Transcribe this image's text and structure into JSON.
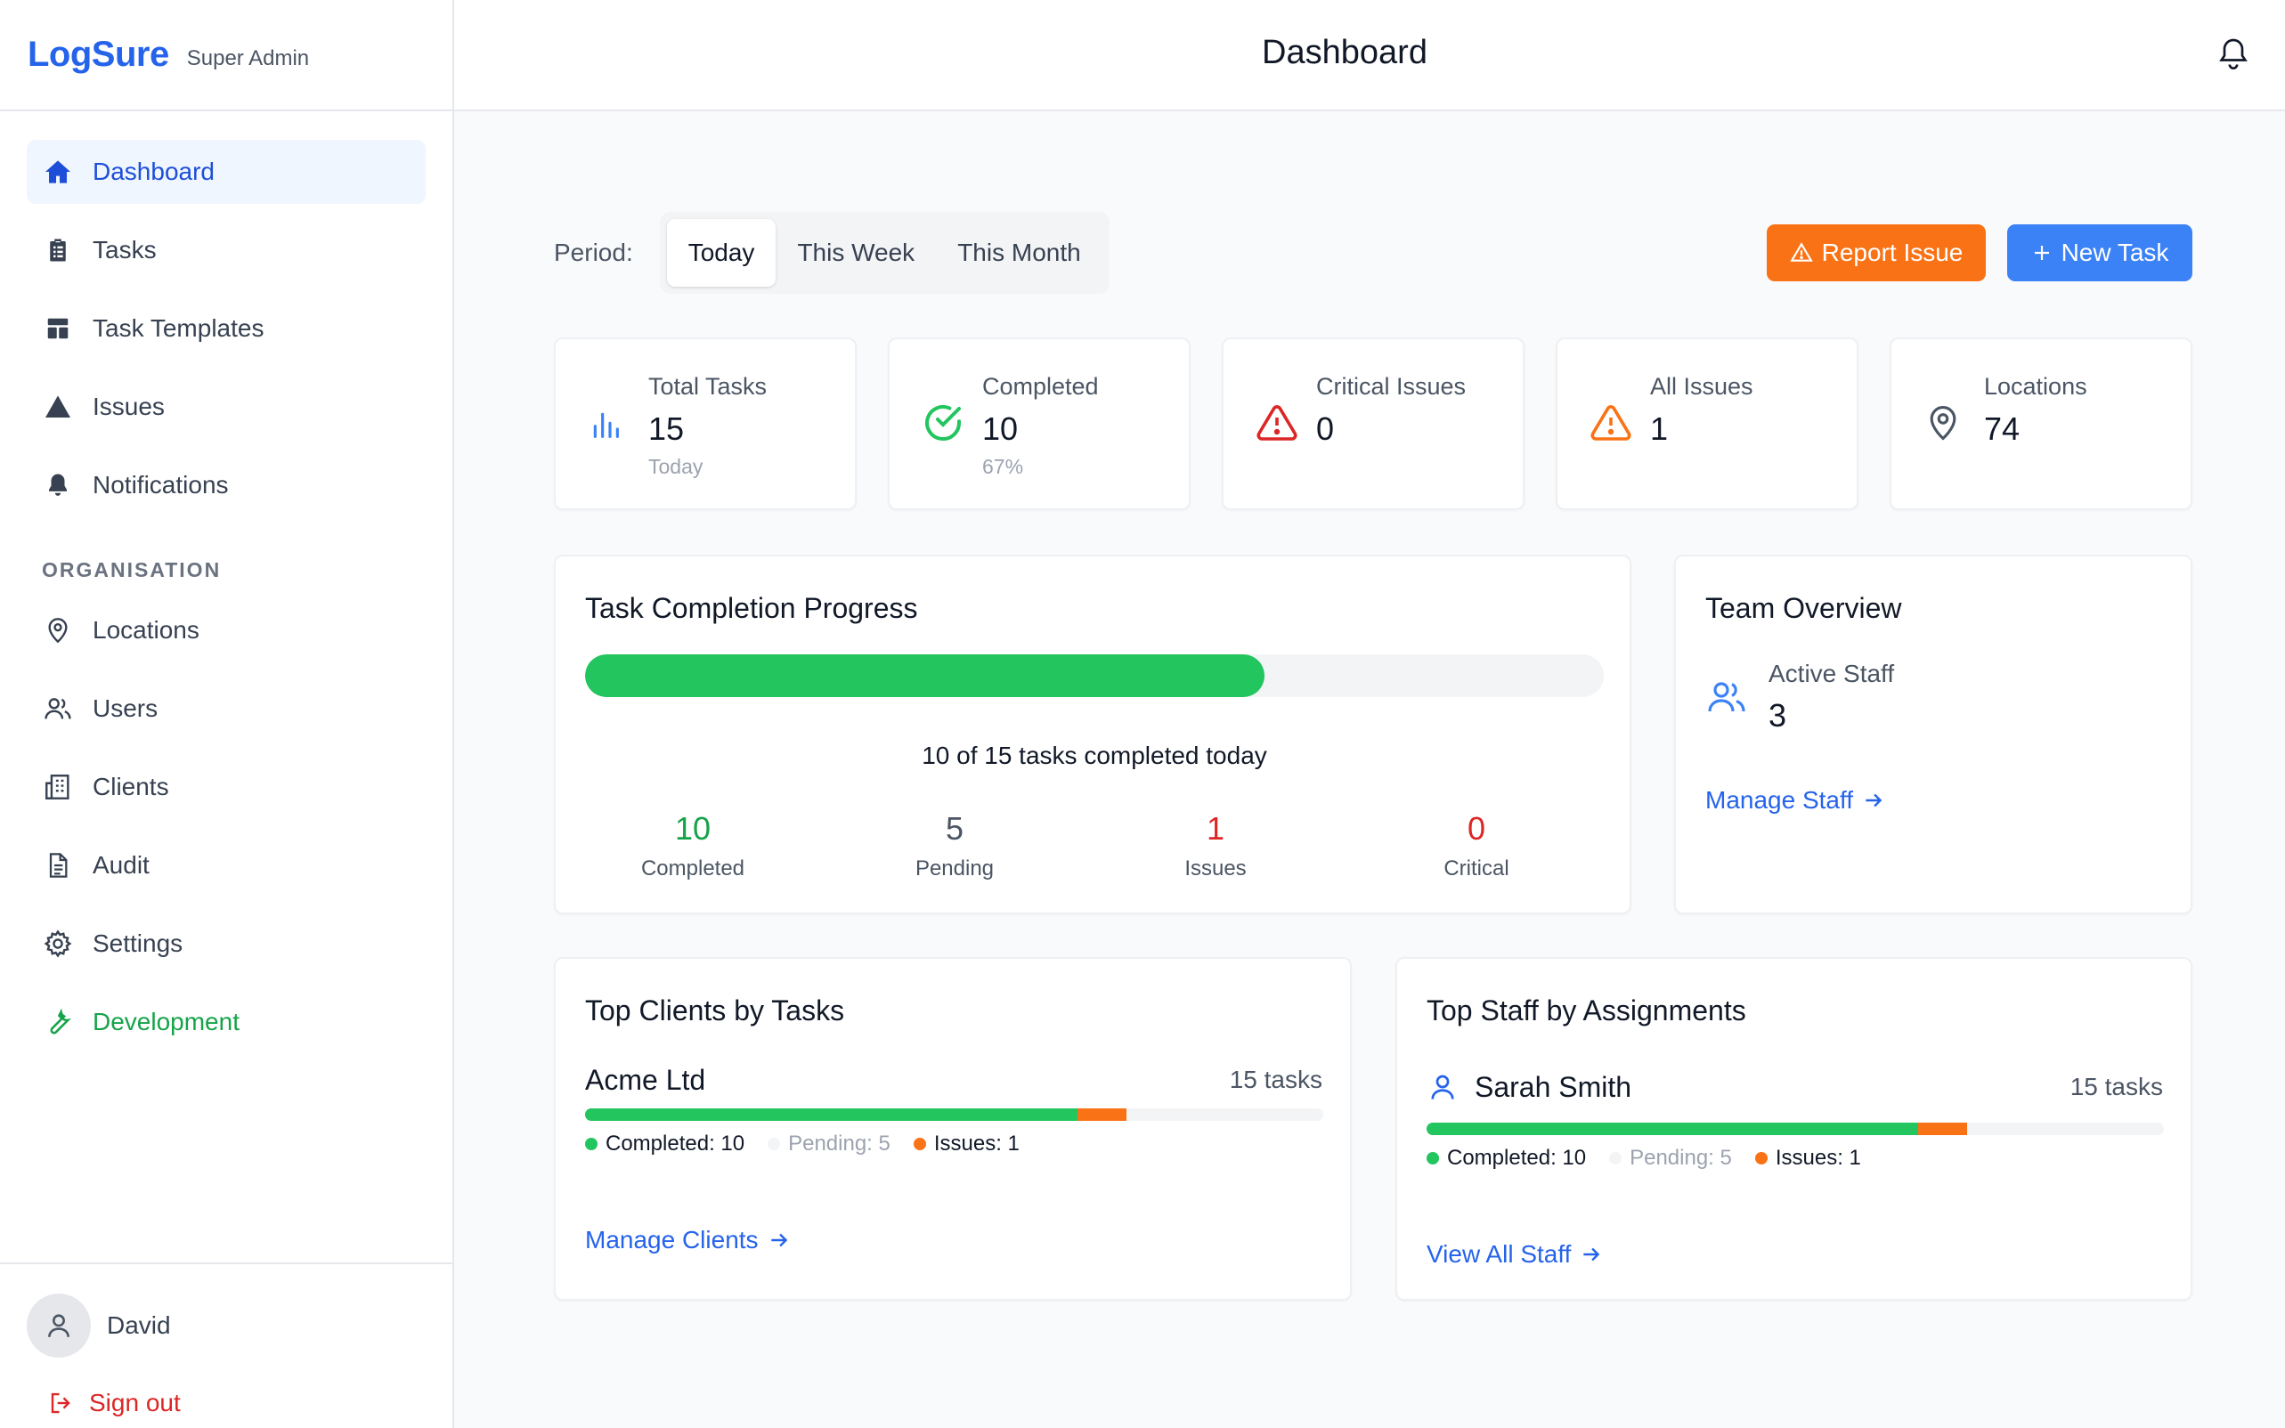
{
  "app": {
    "name": "LogSure",
    "role": "Super Admin"
  },
  "header": {
    "title": "Dashboard"
  },
  "sidebar": {
    "items": [
      {
        "label": "Dashboard",
        "icon": "home-icon"
      },
      {
        "label": "Tasks",
        "icon": "clipboard-icon"
      },
      {
        "label": "Task Templates",
        "icon": "template-icon"
      },
      {
        "label": "Issues",
        "icon": "triangle-icon"
      },
      {
        "label": "Notifications",
        "icon": "bell-icon"
      }
    ],
    "section_label": "ORGANISATION",
    "org_items": [
      {
        "label": "Locations",
        "icon": "map-pin-icon"
      },
      {
        "label": "Users",
        "icon": "users-icon"
      },
      {
        "label": "Clients",
        "icon": "building-icon"
      },
      {
        "label": "Audit",
        "icon": "document-icon"
      },
      {
        "label": "Settings",
        "icon": "gear-icon"
      },
      {
        "label": "Development",
        "icon": "wrench-icon"
      }
    ],
    "user_name": "David",
    "signout_label": "Sign out"
  },
  "period": {
    "label": "Period:",
    "options": [
      "Today",
      "This Week",
      "This Month"
    ],
    "selected": "Today"
  },
  "actions": {
    "report_issue": "Report Issue",
    "new_task": "New Task"
  },
  "stats": [
    {
      "label": "Total Tasks",
      "value": "15",
      "sub": "Today",
      "icon": "bar-chart-icon"
    },
    {
      "label": "Completed",
      "value": "10",
      "sub": "67%",
      "icon": "check-circle-icon"
    },
    {
      "label": "Critical Issues",
      "value": "0",
      "sub": "",
      "icon": "alert-triangle-red-icon"
    },
    {
      "label": "All Issues",
      "value": "1",
      "sub": "",
      "icon": "alert-triangle-orange-icon"
    },
    {
      "label": "Locations",
      "value": "74",
      "sub": "",
      "icon": "map-pin-icon"
    }
  ],
  "progress": {
    "title": "Task Completion Progress",
    "fraction": 0.667,
    "caption": "10 of 15 tasks completed today",
    "stats": [
      {
        "value": "10",
        "label": "Completed",
        "color": "#16a34a"
      },
      {
        "value": "5",
        "label": "Pending",
        "color": "#4b5563"
      },
      {
        "value": "1",
        "label": "Issues",
        "color": "#dc2626"
      },
      {
        "value": "0",
        "label": "Critical",
        "color": "#dc2626"
      }
    ]
  },
  "team": {
    "title": "Team Overview",
    "active_label": "Active Staff",
    "active_value": "3",
    "link": "Manage Staff"
  },
  "top_clients": {
    "title": "Top Clients by Tasks",
    "rows": [
      {
        "name": "Acme Ltd",
        "count": "15 tasks",
        "completed": 10,
        "issues": 1,
        "total": 15,
        "legend": {
          "completed": "Completed: 10",
          "pending": "Pending: 5",
          "issues": "Issues: 1"
        }
      }
    ],
    "link": "Manage Clients"
  },
  "top_staff": {
    "title": "Top Staff by Assignments",
    "rows": [
      {
        "name": "Sarah Smith",
        "count": "15 tasks",
        "completed": 10,
        "issues": 1,
        "total": 15,
        "legend": {
          "completed": "Completed: 10",
          "pending": "Pending: 5",
          "issues": "Issues: 1"
        }
      }
    ],
    "link": "View All Staff"
  },
  "colors": {
    "brand": "#2563eb",
    "green": "#22c55e",
    "orange": "#f97316",
    "red": "#dc2626"
  }
}
